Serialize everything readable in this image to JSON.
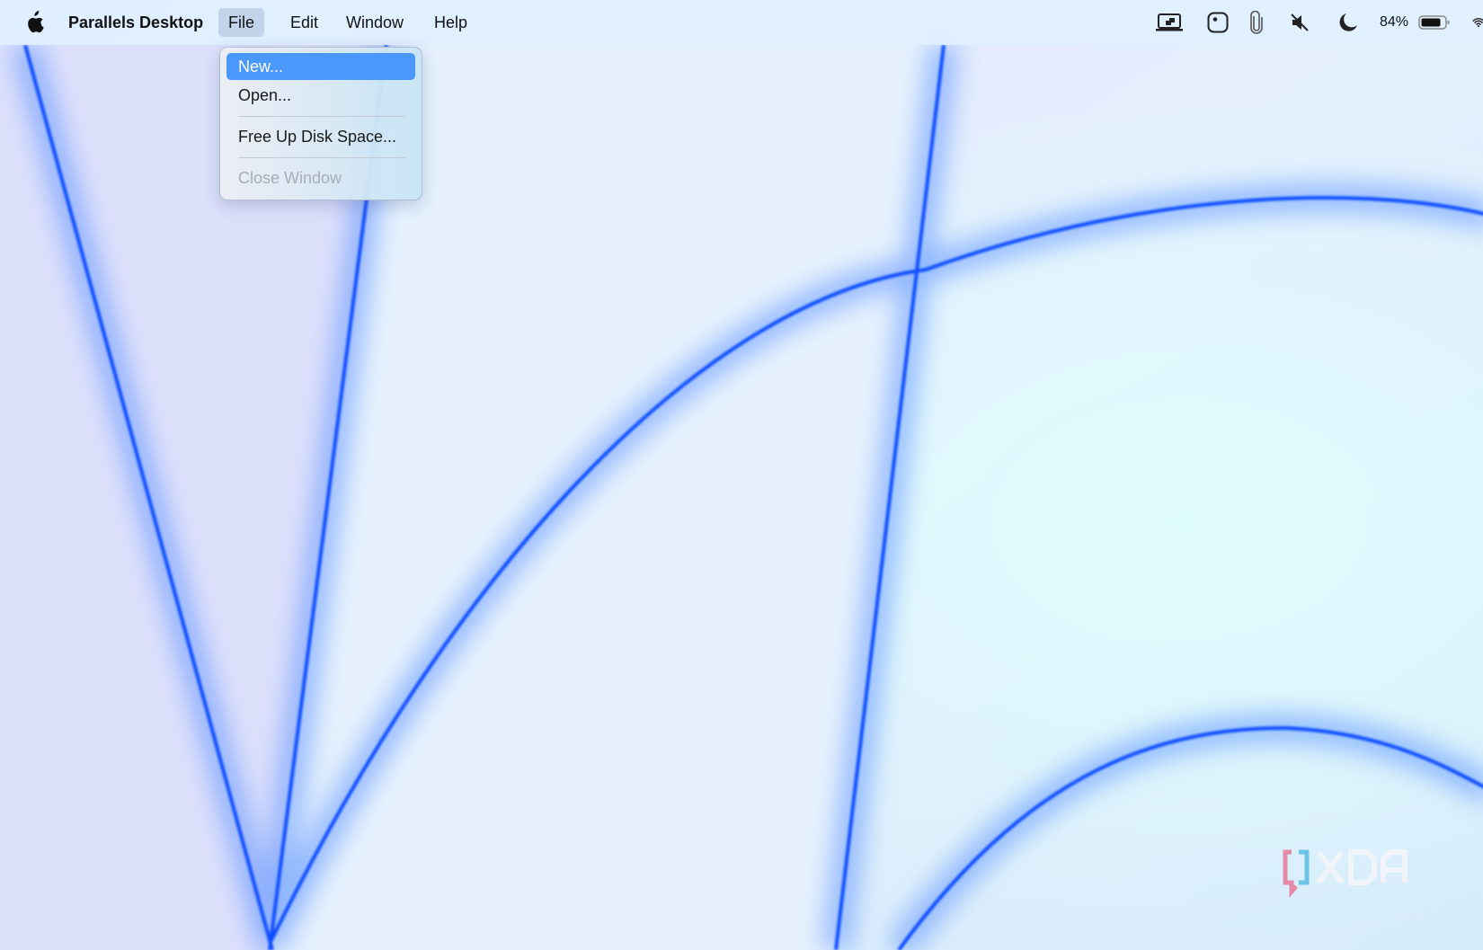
{
  "menubar": {
    "app_name": "Parallels Desktop",
    "menus": [
      "File",
      "Edit",
      "Window",
      "Help"
    ],
    "active_menu": "File",
    "status": {
      "icons": [
        "parallels-screen-icon",
        "focus-dot-icon",
        "paperclip-icon",
        "muted-speaker-icon",
        "moon-icon",
        "battery-icon",
        "wifi-icon"
      ],
      "battery_percent_label": "84%",
      "battery_level": 0.84
    }
  },
  "file_menu": {
    "items": [
      {
        "label": "New...",
        "state": "highlighted"
      },
      {
        "label": "Open...",
        "state": "enabled"
      },
      {
        "label": "Free Up Disk Space...",
        "state": "enabled"
      },
      {
        "label": "Close Window",
        "state": "disabled"
      }
    ],
    "highlight_color": "#4a98fb"
  },
  "watermark": {
    "text": "XDA"
  },
  "colors": {
    "accent_blue": "#1a5cff",
    "wallpaper_light": "#dde6fb"
  }
}
